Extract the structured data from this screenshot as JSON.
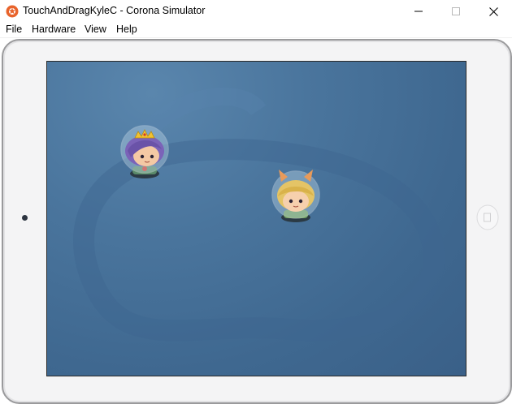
{
  "window": {
    "title": "TouchAndDragKyleC - Corona Simulator",
    "controls": [
      "minimize",
      "maximize",
      "close"
    ]
  },
  "menu": {
    "items": [
      {
        "label": "File"
      },
      {
        "label": "Hardware"
      },
      {
        "label": "View"
      },
      {
        "label": "Help"
      }
    ]
  },
  "simulator": {
    "device": "tablet-landscape",
    "screen_color": "#47719a",
    "sprites": [
      {
        "name": "queen-astronaut",
        "hair": "purple",
        "crown": true
      },
      {
        "name": "bunny-astronaut",
        "hair": "blonde",
        "ears": true
      }
    ]
  },
  "icons": {
    "app": "corona-icon",
    "minimize": "minimize-icon",
    "maximize": "maximize-icon",
    "close": "close-icon"
  }
}
